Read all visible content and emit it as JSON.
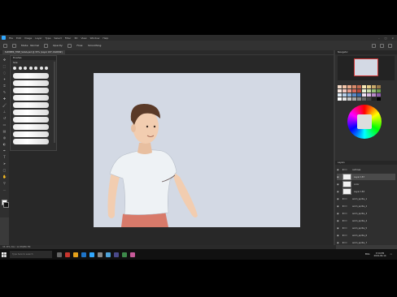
{
  "app": {
    "name": "Photoshop",
    "menu": [
      "File",
      "Edit",
      "Image",
      "Layer",
      "Type",
      "Select",
      "Filter",
      "3D",
      "View",
      "Window",
      "Help"
    ]
  },
  "options_bar": {
    "items": [
      "Mode:",
      "Normal",
      "Opacity:",
      "Flow:",
      "Smoothing:"
    ]
  },
  "document_tab": {
    "title": "SUMMER_TIME_SAGA.psd @ 33% (Layer 187, RGB/8#)"
  },
  "brush_panel": {
    "title": "Brushes",
    "size_label": "Size:"
  },
  "right_panel": {
    "navigator_title": "Navigator",
    "layers_title": "Layers"
  },
  "layers": [
    {
      "name": "outlines",
      "type": "folder"
    },
    {
      "name": "Layer 187",
      "type": "layer",
      "selected": true
    },
    {
      "name": "color",
      "type": "layer"
    },
    {
      "name": "Layer 183",
      "type": "layer"
    },
    {
      "name": "anim_sprite_1",
      "type": "folder"
    },
    {
      "name": "anim_sprite_2",
      "type": "folder"
    },
    {
      "name": "anim_sprite_3",
      "type": "folder"
    },
    {
      "name": "anim_sprite_4",
      "type": "folder"
    },
    {
      "name": "anim_sprite_5",
      "type": "folder"
    },
    {
      "name": "anim_sprite_6",
      "type": "folder"
    },
    {
      "name": "anim_sprite_7",
      "type": "folder"
    }
  ],
  "status_bar": {
    "zoom": "33.33%",
    "doc": "Doc: 12.3M/80.7M"
  },
  "taskbar": {
    "search_placeholder": "Type here to search",
    "language": "ENG",
    "time": "3:59 PM",
    "date": "2019-09-14"
  },
  "colors": {
    "accent": "#31a8ff",
    "canvas_bg": "#d3d9e4",
    "shirt": "#eef2f5",
    "skin": "#f2cdb0",
    "hair": "#5a3a28",
    "pants": "#d87a6a"
  },
  "icons": [
    "windows-icon",
    "search-icon",
    "eye-icon",
    "folder-icon",
    "move-tool-icon",
    "brush-tool-icon"
  ]
}
